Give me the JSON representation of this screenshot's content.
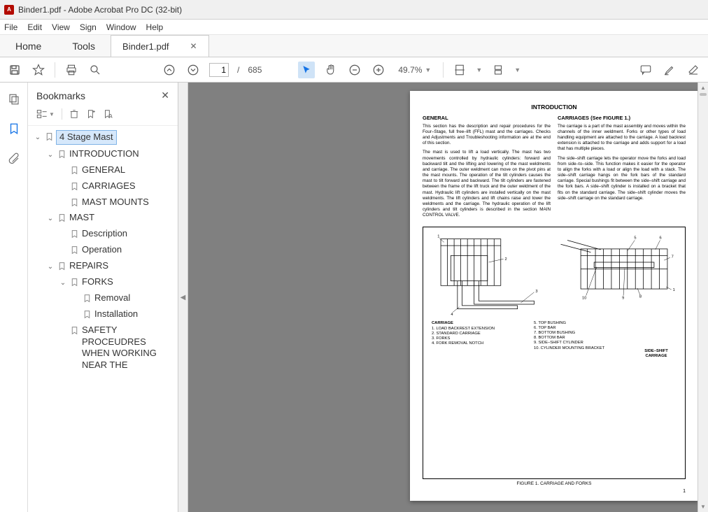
{
  "window": {
    "title": "Binder1.pdf - Adobe Acrobat Pro DC (32-bit)"
  },
  "menu": [
    "File",
    "Edit",
    "View",
    "Sign",
    "Window",
    "Help"
  ],
  "tabs": {
    "home": "Home",
    "tools": "Tools",
    "docs": [
      {
        "label": "Binder1.pdf"
      }
    ]
  },
  "toolbar": {
    "page_current": "1",
    "page_sep": "/",
    "page_total": "685",
    "zoom": "49.7%"
  },
  "bookmarks_panel": {
    "title": "Bookmarks"
  },
  "bookmarks": [
    {
      "indent": 0,
      "chev": "v",
      "label": "4 Stage Mast",
      "selected": true
    },
    {
      "indent": 1,
      "chev": "v",
      "label": "INTRODUCTION"
    },
    {
      "indent": 2,
      "chev": "",
      "label": "GENERAL"
    },
    {
      "indent": 2,
      "chev": "",
      "label": "CARRIAGES"
    },
    {
      "indent": 2,
      "chev": "",
      "label": "MAST MOUNTS"
    },
    {
      "indent": 1,
      "chev": "v",
      "label": "MAST"
    },
    {
      "indent": 2,
      "chev": "",
      "label": "Description"
    },
    {
      "indent": 2,
      "chev": "",
      "label": "Operation"
    },
    {
      "indent": 1,
      "chev": "v",
      "label": "REPAIRS"
    },
    {
      "indent": 2,
      "chev": "v",
      "label": "FORKS"
    },
    {
      "indent": 3,
      "chev": "",
      "label": "Removal"
    },
    {
      "indent": 3,
      "chev": "",
      "label": "Installation"
    },
    {
      "indent": 2,
      "chev": "",
      "label": "SAFETY PROCEUDRES WHEN WORKING NEAR THE"
    }
  ],
  "document": {
    "intro_heading": "INTRODUCTION",
    "left_heading": "GENERAL",
    "right_heading": "CARRIAGES (See FIGURE 1.)",
    "left_p1": "This section has the description and repair procedures for the Four–Stage, full free–lift (FFL) mast and the carriages. Checks and Adjustments and Troubleshooting information are at the end of this section.",
    "left_p2": "The mast is used to lift a load vertically. The mast has two movements controlled by hydraulic cylinders: forward and backward tilt and the lifting and lowering of the mast weldments and carriage. The outer weldment can move on the pivot pins at the mast mounts. The operation of the tilt cylinders causes the mast to tilt forward and backward. The tilt cylinders are fastened between the frame of the lift truck and the outer weldment of the mast. Hydraulic lift cylinders are installed vertically on the mast weldments. The lift cylinders and lift chains raise and lower the weldments and the carriage. The hydraulic operation of the lift cylinders and tilt cylinders is described in the section MAIN CONTROL VALVE.",
    "right_p1": "The carriage is a part of the mast assembly and moves within the channels of the inner weldment. Forks or other types of load handling equipment are attached to the carriage. A load backrest extension is attached to the carriage and adds support for a load that has multiple pieces.",
    "right_p2": "The side–shift carriage lets the operator move the forks and load from side–to–side. This function makes it easier for the operator to align the forks with a load or align the load with a stack. The side–shift carriage hangs on the fork bars of the standard carriage. Special bushings fit between the side–shift carriage and the fork bars. A side–shift cylinder is installed on a bracket that fits on the standard carriage. The side–shift cylinder moves the side–shift carriage on the standard carriage.",
    "fig_left_title": "CARRIAGE",
    "fig_left_items": "1. LOAD BACKREST EXTENSION\n2. STANDARD CARRIAGE\n3. FORKS\n4. FORK REMOVAL NOTCH",
    "fig_right_title": "SIDE–SHIFT CARRIAGE",
    "fig_right_items": "5. TOP BUSHING\n6. TOP BAR\n7. BOTTOM BUSHING\n8. BOTTOM BAR\n9. SIDE–SHIFT CYLINDER\n10. CYLINDER MOUNTING BRACKET",
    "fig_caption": "FIGURE 1. CARRIAGE AND FORKS",
    "page_number": "1"
  }
}
